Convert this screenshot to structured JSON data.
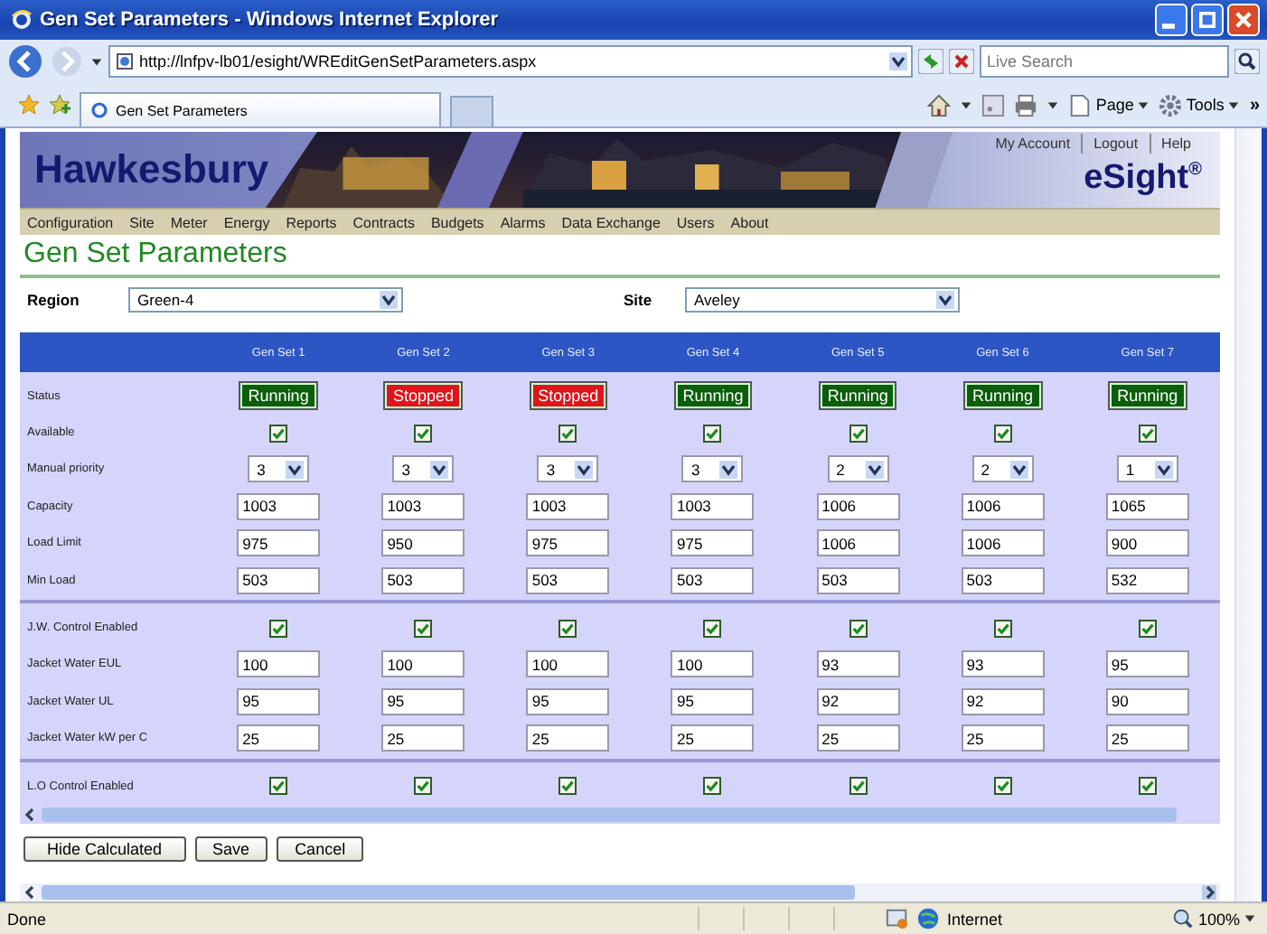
{
  "window": {
    "title": "Gen Set Parameters - Windows Internet Explorer"
  },
  "address_bar": {
    "url": "http://lnfpv-lb01/esight/WREditGenSetParameters.aspx",
    "search_placeholder": "Live Search"
  },
  "tabs": [
    {
      "label": "Gen Set Parameters",
      "selected": true
    }
  ],
  "toolbar": {
    "page": "Page",
    "tools": "Tools",
    "more": "»"
  },
  "banner": {
    "brand": "Hawkesbury",
    "product": "eSight$^{®}$",
    "links": [
      "My Account",
      "Logout",
      "Help"
    ]
  },
  "nav": [
    "Configuration",
    "Site",
    "Meter",
    "Energy",
    "Reports",
    "Contracts",
    "Budgets",
    "Alarms",
    "Data Exchange",
    "Users",
    "About"
  ],
  "page_title": "Gen Set Parameters",
  "filters": [
    {
      "label": "Region",
      "value": "Green-4"
    },
    {
      "label": "Site",
      "value": "Aveley"
    }
  ],
  "table": {
    "columns": [
      "Gen Set 1",
      "Gen Set 2",
      "Gen Set 3",
      "Gen Set 4",
      "Gen Set 5",
      "Gen Set 6",
      "Gen Set 7"
    ],
    "groups": [
      {
        "rows": [
          {
            "label": "Status",
            "kind": "status",
            "cells": [
              {
                "text": "Running",
                "color": "#0b5e0b"
              },
              {
                "text": "Stopped",
                "color": "#e0141a"
              },
              {
                "text": "Stopped",
                "color": "#e0141a"
              },
              {
                "text": "Running",
                "color": "#0b5e0b"
              },
              {
                "text": "Running",
                "color": "#0b5e0b"
              },
              {
                "text": "Running",
                "color": "#0b5e0b"
              },
              {
                "text": "Running",
                "color": "#0b5e0b"
              }
            ]
          },
          {
            "label": "Available",
            "kind": "checkbox",
            "cells": [
              {
                "checked": true
              },
              {
                "checked": true
              },
              {
                "checked": true
              },
              {
                "checked": true
              },
              {
                "checked": true
              },
              {
                "checked": true
              },
              {
                "checked": true
              }
            ]
          },
          {
            "label": "Manual priority",
            "kind": "select",
            "cells": [
              {
                "value": "3"
              },
              {
                "value": "3"
              },
              {
                "value": "3"
              },
              {
                "value": "3"
              },
              {
                "value": "2"
              },
              {
                "value": "2"
              },
              {
                "value": "1"
              }
            ]
          },
          {
            "label": "Capacity",
            "kind": "input",
            "cells": [
              {
                "value": "1003"
              },
              {
                "value": "1003"
              },
              {
                "value": "1003"
              },
              {
                "value": "1003"
              },
              {
                "value": "1006"
              },
              {
                "value": "1006"
              },
              {
                "value": "1065"
              }
            ]
          },
          {
            "label": "Load Limit",
            "kind": "input",
            "cells": [
              {
                "value": "975"
              },
              {
                "value": "950"
              },
              {
                "value": "975"
              },
              {
                "value": "975"
              },
              {
                "value": "1006"
              },
              {
                "value": "1006"
              },
              {
                "value": "900"
              }
            ]
          },
          {
            "label": "Min Load",
            "kind": "input",
            "cells": [
              {
                "value": "503"
              },
              {
                "value": "503"
              },
              {
                "value": "503"
              },
              {
                "value": "503"
              },
              {
                "value": "503"
              },
              {
                "value": "503"
              },
              {
                "value": "532"
              }
            ]
          }
        ]
      },
      {
        "rows": [
          {
            "label": "J.W. Control Enabled",
            "kind": "checkbox",
            "cells": [
              {
                "checked": true
              },
              {
                "checked": true
              },
              {
                "checked": true
              },
              {
                "checked": true
              },
              {
                "checked": true
              },
              {
                "checked": true
              },
              {
                "checked": true
              }
            ]
          },
          {
            "label": "Jacket Water EUL",
            "kind": "input",
            "cells": [
              {
                "value": "100"
              },
              {
                "value": "100"
              },
              {
                "value": "100"
              },
              {
                "value": "100"
              },
              {
                "value": "93"
              },
              {
                "value": "93"
              },
              {
                "value": "95"
              }
            ]
          },
          {
            "label": "Jacket Water UL",
            "kind": "input",
            "cells": [
              {
                "value": "95"
              },
              {
                "value": "95"
              },
              {
                "value": "95"
              },
              {
                "value": "95"
              },
              {
                "value": "92"
              },
              {
                "value": "92"
              },
              {
                "value": "90"
              }
            ]
          },
          {
            "label": "Jacket Water kW per C",
            "kind": "input",
            "cells": [
              {
                "value": "25"
              },
              {
                "value": "25"
              },
              {
                "value": "25"
              },
              {
                "value": "25"
              },
              {
                "value": "25"
              },
              {
                "value": "25"
              },
              {
                "value": "25"
              }
            ]
          }
        ]
      },
      {
        "rows": [
          {
            "label": "L.O Control Enabled",
            "kind": "checkbox",
            "cells": [
              {
                "checked": true
              },
              {
                "checked": true
              },
              {
                "checked": true
              },
              {
                "checked": true
              },
              {
                "checked": true
              },
              {
                "checked": true
              },
              {
                "checked": true
              }
            ]
          }
        ]
      }
    ]
  },
  "buttons": [
    "Hide Calculated",
    "Save",
    "Cancel"
  ],
  "status_bar": {
    "text": "Done",
    "zone": "Internet",
    "zoom": "100%"
  }
}
